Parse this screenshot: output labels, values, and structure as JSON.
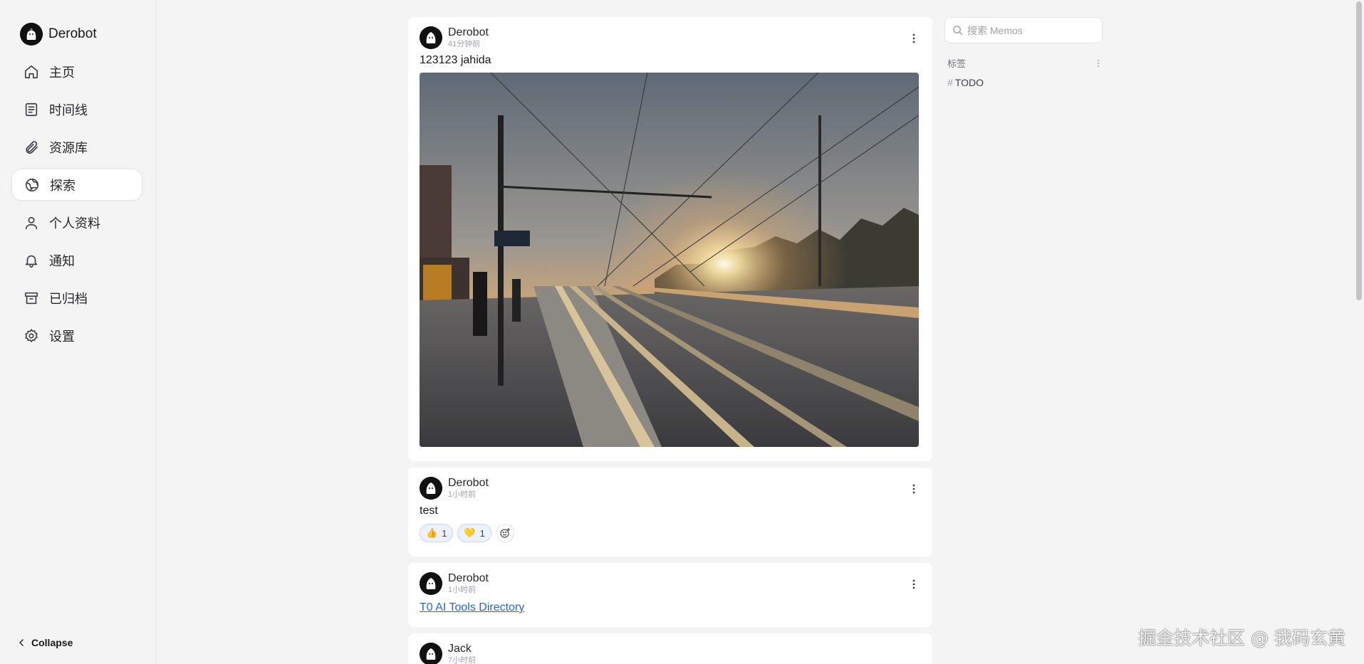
{
  "brand": {
    "name": "Derobot"
  },
  "nav": {
    "items": [
      {
        "label": "主页",
        "icon": "home-icon"
      },
      {
        "label": "时间线",
        "icon": "timeline-icon"
      },
      {
        "label": "资源库",
        "icon": "paperclip-icon"
      },
      {
        "label": "探索",
        "icon": "globe-icon",
        "active": true
      },
      {
        "label": "个人资料",
        "icon": "user-icon"
      },
      {
        "label": "通知",
        "icon": "bell-icon"
      },
      {
        "label": "已归档",
        "icon": "archive-icon"
      },
      {
        "label": "设置",
        "icon": "gear-icon"
      }
    ],
    "collapse_label": "Collapse"
  },
  "memos": [
    {
      "author": "Derobot",
      "time": "41分钟前",
      "content": "123123 jahida",
      "has_image": true
    },
    {
      "author": "Derobot",
      "time": "1小时前",
      "content": "test",
      "reactions": [
        {
          "emoji": "👍",
          "count": "1"
        },
        {
          "emoji": "💛",
          "count": "1"
        }
      ]
    },
    {
      "author": "Derobot",
      "time": "1小时前",
      "link": "T0 AI Tools Directory"
    },
    {
      "author": "Jack",
      "time": "7小时前"
    }
  ],
  "right": {
    "search_placeholder": "搜索 Memos",
    "tags_title": "标签",
    "tags": [
      {
        "hash": "#",
        "name": "TODO"
      }
    ]
  },
  "watermark": "掘金技术社区 @ 我码玄黄",
  "colors": {
    "accent": "#2563eb",
    "reaction_bg": "#eef2ff"
  }
}
